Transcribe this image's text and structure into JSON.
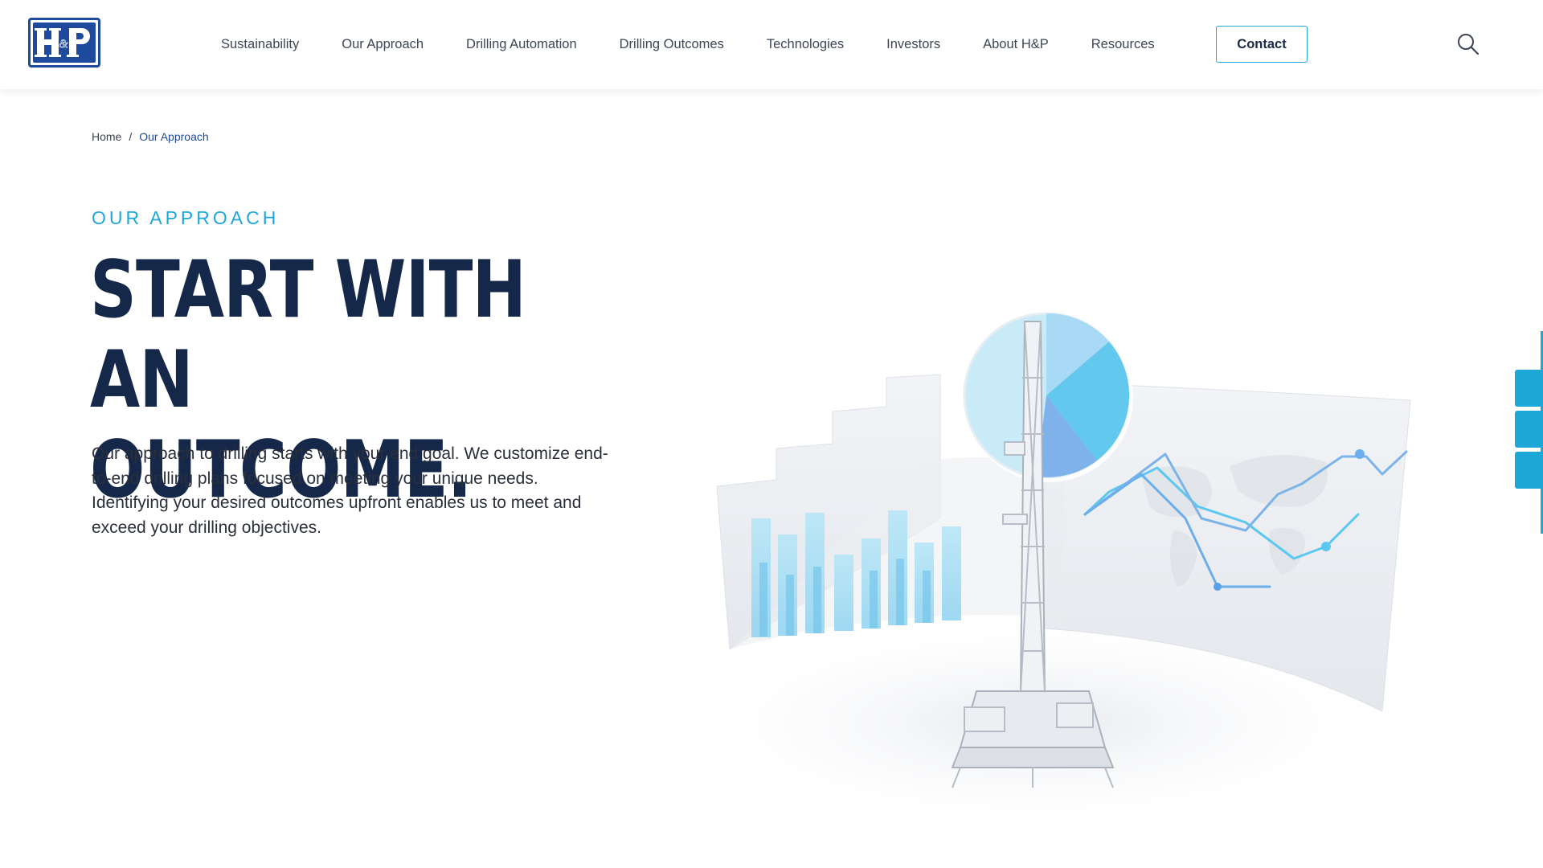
{
  "header": {
    "logo_alt": "H&P",
    "nav": [
      {
        "label": "Sustainability"
      },
      {
        "label": "Our Approach"
      },
      {
        "label": "Drilling Automation"
      },
      {
        "label": "Drilling Outcomes"
      },
      {
        "label": "Technologies"
      },
      {
        "label": "Investors"
      },
      {
        "label": "About H&P"
      },
      {
        "label": "Resources"
      }
    ],
    "contact_label": "Contact",
    "search_icon": "search-icon"
  },
  "breadcrumb": {
    "home": "Home",
    "separator": "/",
    "current": "Our Approach"
  },
  "hero": {
    "eyebrow": "OUR APPROACH",
    "headline_line1": "START WITH AN",
    "headline_line2": "OUTCOME.",
    "body": "Our approach to drilling starts with your end goal. We customize end-to-end drilling plans focused on meeting your unique needs. Identifying your desired outcomes upfront enables us to meet and exceed your drilling objectives."
  },
  "colors": {
    "accent": "#1ea7d9",
    "brand_blue": "#1d4a9c",
    "headline": "#16284a"
  }
}
